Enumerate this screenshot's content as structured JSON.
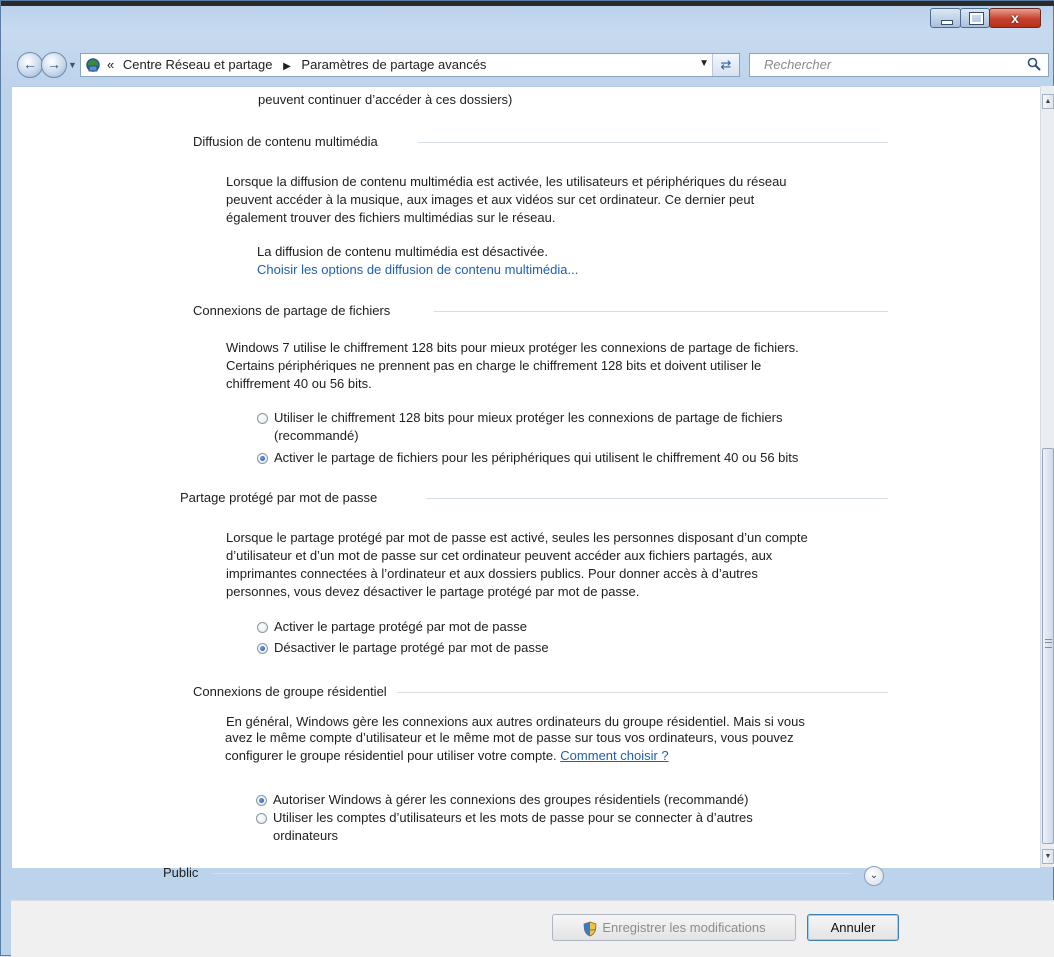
{
  "window": {
    "close_glyph": "x"
  },
  "address_bar": {
    "chevrons": "«",
    "crumb1": "Centre Réseau et partage",
    "crumb2": "Paramètres de partage avancés",
    "separator": "▶"
  },
  "search": {
    "placeholder": "Rechercher"
  },
  "content": {
    "top_line": "peuvent continuer d’accéder à ces dossiers)",
    "media": {
      "title": "Diffusion de contenu multimédia",
      "desc_lines": [
        "Lorsque la diffusion de contenu multimédia est activée, les utilisateurs et périphériques du réseau",
        "peuvent accéder à la musique, aux images et aux vidéos sur cet ordinateur. Ce dernier peut",
        "également trouver des fichiers multimédias sur le réseau."
      ],
      "status": "La diffusion de contenu multimédia est désactivée.",
      "link": "Choisir les options de diffusion de contenu multimédia..."
    },
    "file_sharing": {
      "title": "Connexions de partage de fichiers",
      "desc_lines": [
        "Windows 7 utilise le chiffrement 128 bits pour mieux protéger les connexions de partage de fichiers.",
        "Certains périphériques ne prennent pas en charge le chiffrement 128 bits et doivent utiliser le",
        "chiffrement 40 ou 56 bits."
      ],
      "option1_line1": "Utiliser le chiffrement 128 bits pour mieux protéger les connexions de partage de fichiers",
      "option1_line2": "(recommandé)",
      "option2": "Activer le partage de fichiers pour les périphériques qui utilisent le chiffrement 40 ou 56 bits",
      "selected": 2
    },
    "password": {
      "title": "Partage protégé par mot de passe",
      "desc_lines": [
        "Lorsque le partage protégé par mot de passe est activé, seules les personnes disposant d’un compte",
        "d’utilisateur et d’un mot de passe sur cet ordinateur peuvent accéder aux fichiers partagés, aux",
        "imprimantes connectées à l’ordinateur et aux dossiers publics. Pour donner accès à d’autres",
        "personnes, vous devez désactiver le partage protégé par mot de passe."
      ],
      "option1": "Activer le partage protégé par mot de passe",
      "option2": "Désactiver le partage protégé par mot de passe",
      "selected": 2
    },
    "homegroup": {
      "title": "Connexions de groupe résidentiel",
      "desc_line1": "En général, Windows gère les connexions aux autres ordinateurs du groupe résidentiel. Mais si vous",
      "desc_line2": "avez le même compte d’utilisateur et le même mot de passe sur tous vos ordinateurs, vous pouvez",
      "desc_line3": "configurer le groupe résidentiel pour utiliser votre compte.",
      "desc_link": "Comment choisir ?",
      "option1": "Autoriser Windows à gérer les connexions des groupes résidentiels (recommandé)",
      "option2_line1": "Utiliser les comptes d’utilisateurs et les mots de passe pour se connecter à d’autres",
      "option2_line2": "ordinateurs",
      "selected": 1
    },
    "public": {
      "title": "Public"
    }
  },
  "footer": {
    "save_label": "Enregistrer les modifications",
    "cancel_label": "Annuler"
  },
  "colors": {
    "link": "#1e5fb3",
    "close_button": "#c7402b",
    "disabled_text": "#8d8d8d"
  },
  "icons": [
    "network-center-icon",
    "back-arrow-icon",
    "forward-arrow-icon",
    "refresh-icon",
    "search-icon",
    "shield-icon",
    "expand-chevron-icon"
  ]
}
